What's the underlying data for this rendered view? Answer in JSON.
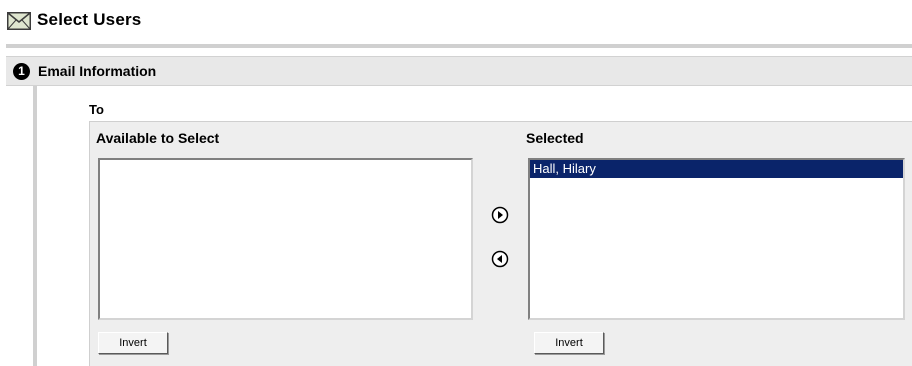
{
  "header": {
    "title": "Select Users",
    "icon": "envelope-icon"
  },
  "step": {
    "number": "1",
    "label": "Email Information"
  },
  "recipients": {
    "field_label": "To",
    "available": {
      "heading": "Available to Select",
      "options": [],
      "invert_label": "Invert"
    },
    "selected": {
      "heading": "Selected",
      "options": [
        {
          "label": "Hall, Hilary",
          "highlighted": true
        }
      ],
      "invert_label": "Invert"
    },
    "move_right_icon": "circle-arrow-right-icon",
    "move_left_icon": "circle-arrow-left-icon"
  },
  "colors": {
    "selection": "#0a246a",
    "panel": "#eeeeee",
    "rule": "#d0d0d0"
  }
}
